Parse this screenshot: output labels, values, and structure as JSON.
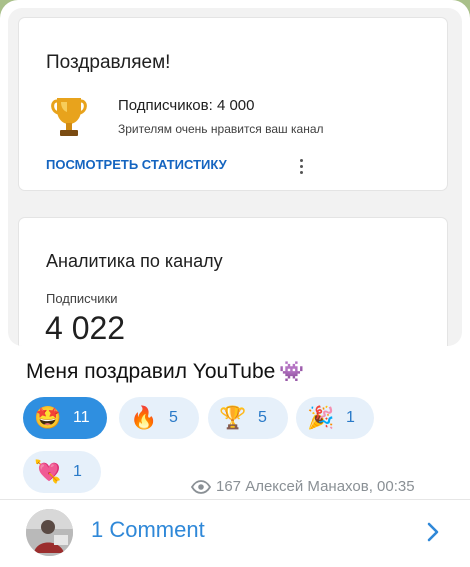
{
  "card_congrats": {
    "title": "Поздравляем!",
    "subscribers_line": "Подписчиков: 4 000",
    "viewers_line": "Зрителям очень нравится ваш канал",
    "stats_link": "ПОСМОТРЕТЬ СТАТИСТИКУ",
    "icon": "trophy-icon"
  },
  "card_analytics": {
    "title": "Аналитика по каналу",
    "subscribers_label": "Подписчики",
    "subscribers_value": "4 022"
  },
  "message": {
    "caption": "Меня поздравил YouTube",
    "caption_emoji": "👾"
  },
  "reactions": [
    {
      "emoji": "🤩",
      "count": "11",
      "active": true
    },
    {
      "emoji": "🔥",
      "count": "5",
      "active": false
    },
    {
      "emoji": "🏆",
      "count": "5",
      "active": false
    },
    {
      "emoji": "🎉",
      "count": "1",
      "active": false
    },
    {
      "emoji": "💘",
      "count": "1",
      "active": false
    }
  ],
  "meta": {
    "views": "167",
    "author": "Алексей Манахов",
    "time": "00:35"
  },
  "comments": {
    "label": "1 Comment"
  },
  "colors": {
    "accent": "#2f88d8",
    "link": "#1565c0",
    "active_reaction": "#2f8fe0",
    "reaction_bg": "#e6f0fa",
    "chat_background": "#a9c08a"
  }
}
